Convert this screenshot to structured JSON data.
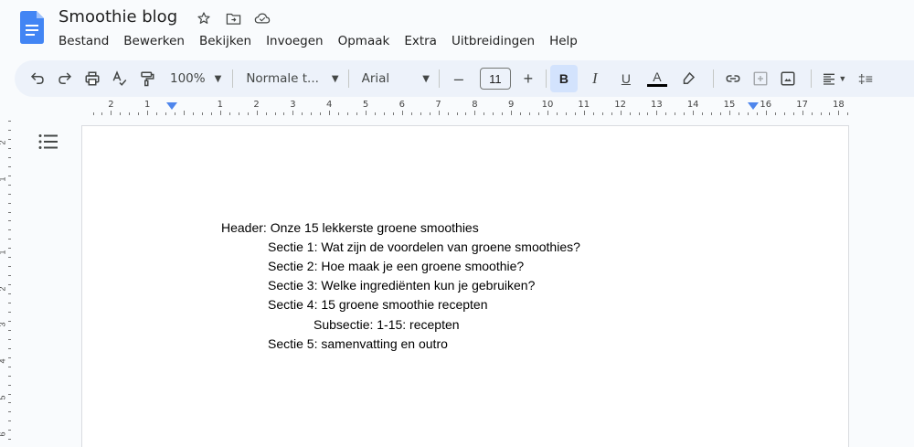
{
  "doc": {
    "title": "Smoothie blog"
  },
  "menu": [
    "Bestand",
    "Bewerken",
    "Bekijken",
    "Invoegen",
    "Opmaak",
    "Extra",
    "Uitbreidingen",
    "Help"
  ],
  "toolbar": {
    "zoom": "100%",
    "style": "Normale t...",
    "font": "Arial",
    "font_size": "11",
    "bold_label": "B",
    "italic_label": "I",
    "underline_label": "U",
    "text_color_label": "A",
    "minus_label": "–",
    "plus_label": "+",
    "line_spacing_label": "‡≡"
  },
  "ruler": {
    "numbers": [
      "2",
      "1",
      "",
      "1",
      "2",
      "3",
      "4",
      "5",
      "6",
      "7",
      "8",
      "9",
      "10",
      "11",
      "12",
      "13",
      "14",
      "15",
      "16",
      "17",
      "18"
    ]
  },
  "vruler": {
    "numbers": [
      "2",
      "1",
      "",
      "1",
      "2",
      "3",
      "4",
      "5",
      "6"
    ]
  },
  "content": {
    "lines": [
      "Header: Onze 15 lekkerste groene smoothies",
      "Sectie 1: Wat zijn de voordelen van groene smoothies?",
      "Sectie 2: Hoe maak je een groene smoothie?",
      "Sectie 3: Welke ingrediënten kun je gebruiken?",
      "Sectie 4: 15 groene smoothie recepten",
      "Subsectie: 1-15: recepten",
      "Sectie 5: samenvatting en outro"
    ]
  },
  "colors": {
    "accent": "#1a73e8",
    "toolbar_bg": "#edf2fa",
    "bold_active": "#d3e3fd"
  }
}
